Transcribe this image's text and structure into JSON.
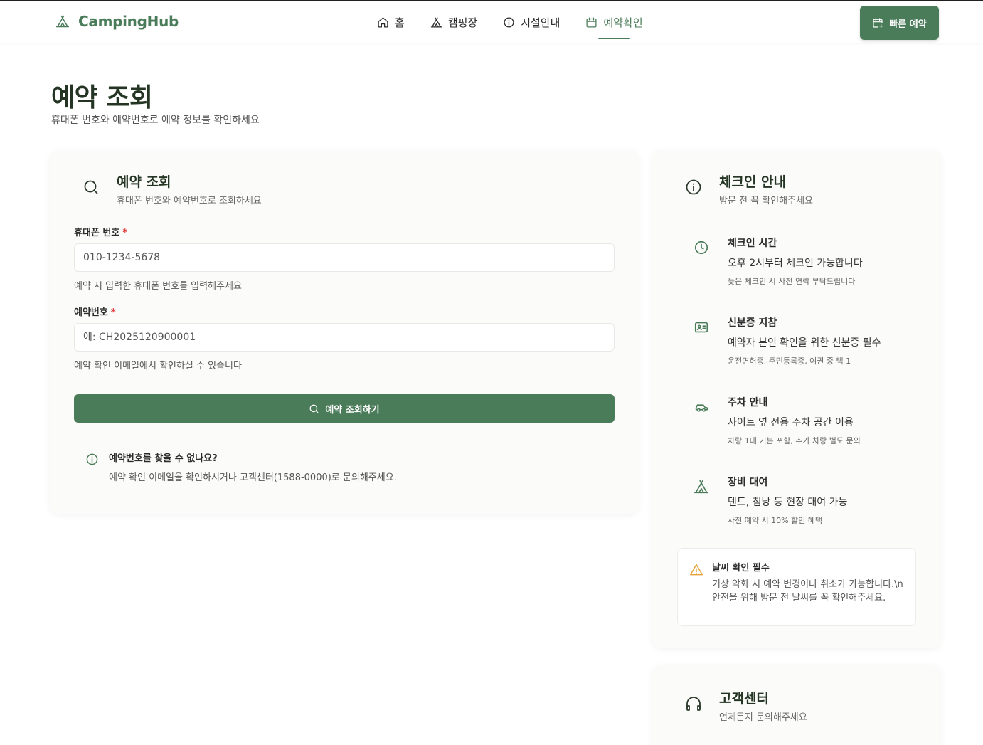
{
  "header": {
    "logo_text": "CampingHub",
    "nav": [
      {
        "label": "홈"
      },
      {
        "label": "캠핑장"
      },
      {
        "label": "시설안내"
      },
      {
        "label": "예약확인"
      }
    ],
    "quick_button": "빠른 예약"
  },
  "page": {
    "title": "예약 조회",
    "subtitle": "휴대폰 번호와 예약번호로 예약 정보를 확인하세요"
  },
  "lookup": {
    "title": "예약 조회",
    "subtitle": "휴대폰 번호와 예약번호로 조회하세요",
    "phone_label": "휴대폰 번호",
    "required_mark": "*",
    "phone_placeholder": "010-1234-5678",
    "phone_hint": "예약 시 입력한 휴대폰 번호를 입력해주세요",
    "reservation_label": "예약번호",
    "reservation_placeholder": "예: CH2025120900001",
    "reservation_hint": "예약 확인 이메일에서 확인하실 수 있습니다",
    "submit": "예약 조회하기",
    "help_title": "예약번호를 찾을 수 없나요?",
    "help_text": "예약 확인 이메일을 확인하시거나 고객센터(1588-0000)로 문의해주세요."
  },
  "checkin": {
    "title": "체크인 안내",
    "subtitle": "방문 전 꼭 확인해주세요",
    "items": [
      {
        "icon": "clock-icon",
        "title": "체크인 시간",
        "main": "오후 2시부터 체크인 가능합니다",
        "sub": "늦은 체크인 시 사전 연락 부탁드립니다"
      },
      {
        "icon": "id-card-icon",
        "title": "신분증 지참",
        "main": "예약자 본인 확인을 위한 신분증 필수",
        "sub": "운전면허증, 주민등록증, 여권 중 택 1"
      },
      {
        "icon": "car-icon",
        "title": "주차 안내",
        "main": "사이트 옆 전용 주차 공간 이용",
        "sub": "차량 1대 기본 포함, 추가 차량 별도 문의"
      },
      {
        "icon": "tent-icon",
        "title": "장비 대여",
        "main": "텐트, 침낭 등 현장 대여 가능",
        "sub": "사전 예약 시 10% 할인 혜택"
      }
    ],
    "warning_title": "날씨 확인 필수",
    "warning_text": "기상 악화 시 예약 변경이나 취소가 가능합니다.\\n안전을 위해 방문 전 날씨를 꼭 확인해주세요."
  },
  "support": {
    "title": "고객센터",
    "subtitle": "언제든지 문의해주세요"
  },
  "colors": {
    "brand": "#4a7c59",
    "required": "#dd3333",
    "warning": "#e8a33b"
  }
}
